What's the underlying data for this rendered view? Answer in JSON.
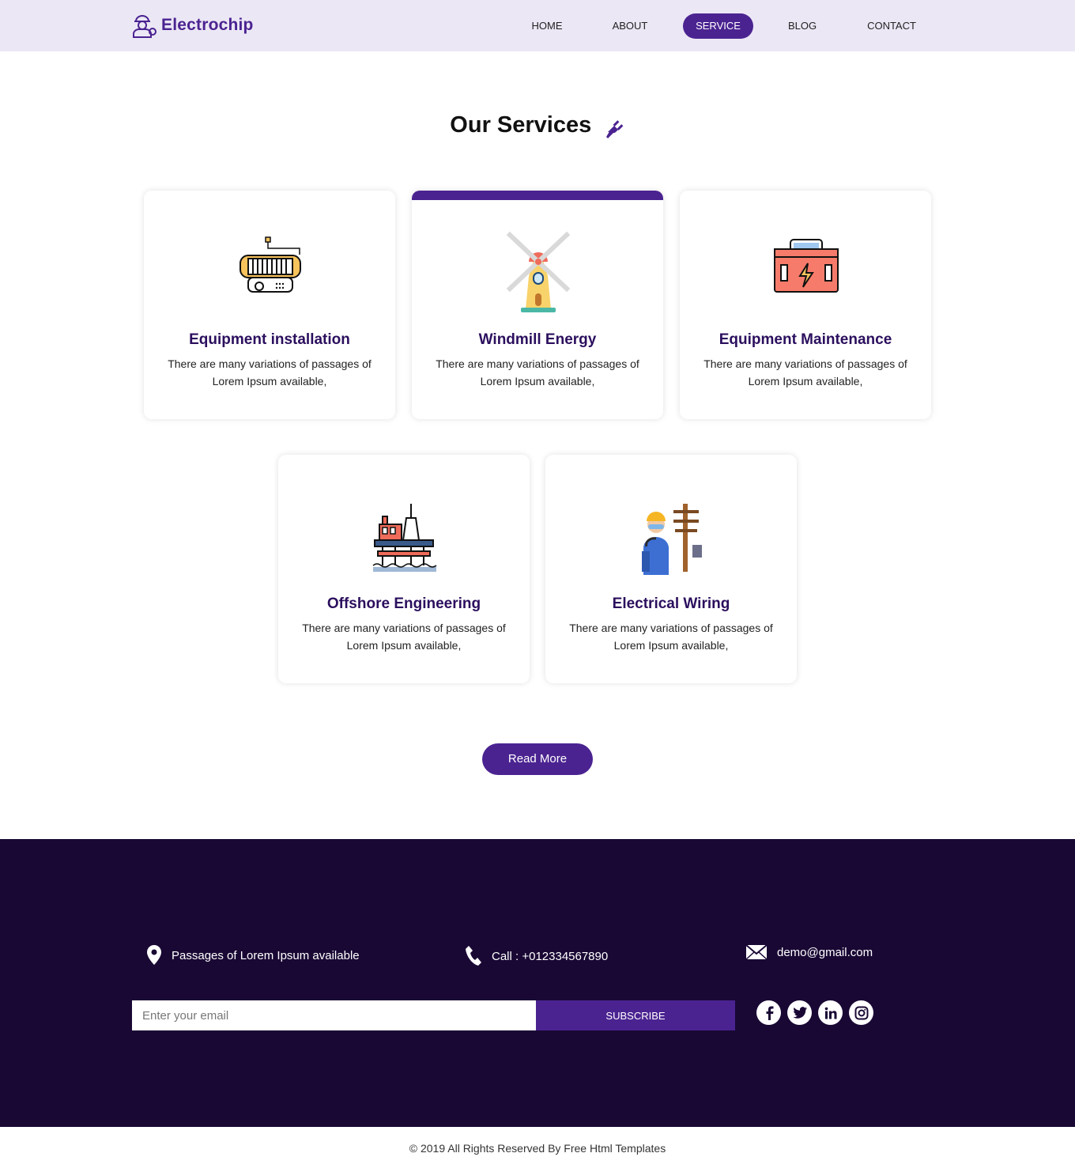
{
  "brand": {
    "name": "Electrochip",
    "accent": "#4b2391",
    "header_bg": "#ebe7f5",
    "footer_bg": "#190834"
  },
  "nav": {
    "home": "HOME",
    "about": "ABOUT",
    "service": "SERVICE",
    "blog": "BLOG",
    "contact": "CONTACT",
    "active": "SERVICE"
  },
  "services": {
    "title": "Our Services",
    "title_icon": "plug-icon",
    "cards": [
      {
        "title": "Equipment installation",
        "text": "There are many variations of passages of Lorem Ipsum available,",
        "icon": "generator-icon"
      },
      {
        "title": "Windmill Energy",
        "text": "There are many variations of passages of Lorem Ipsum available,",
        "icon": "windmill-icon"
      },
      {
        "title": "Equipment Maintenance",
        "text": "There are many variations of passages of Lorem Ipsum available,",
        "icon": "toolbox-icon"
      },
      {
        "title": "Offshore Engineering",
        "text": "There are many variations of passages of Lorem Ipsum available,",
        "icon": "oil-rig-icon"
      },
      {
        "title": "Electrical Wiring",
        "text": "There are many variations of passages of Lorem Ipsum available,",
        "icon": "electrician-icon"
      }
    ],
    "read_more": "Read More"
  },
  "footer": {
    "address": "Passages of Lorem Ipsum available",
    "phone": "Call : +012334567890",
    "email": "demo@gmail.com",
    "email_placeholder": "Enter your email",
    "subscribe": "SUBSCRIBE",
    "social": [
      "facebook-icon",
      "twitter-icon",
      "linkedin-icon",
      "instagram-icon"
    ]
  },
  "copyright": "© 2019 All Rights Reserved By Free Html Templates"
}
